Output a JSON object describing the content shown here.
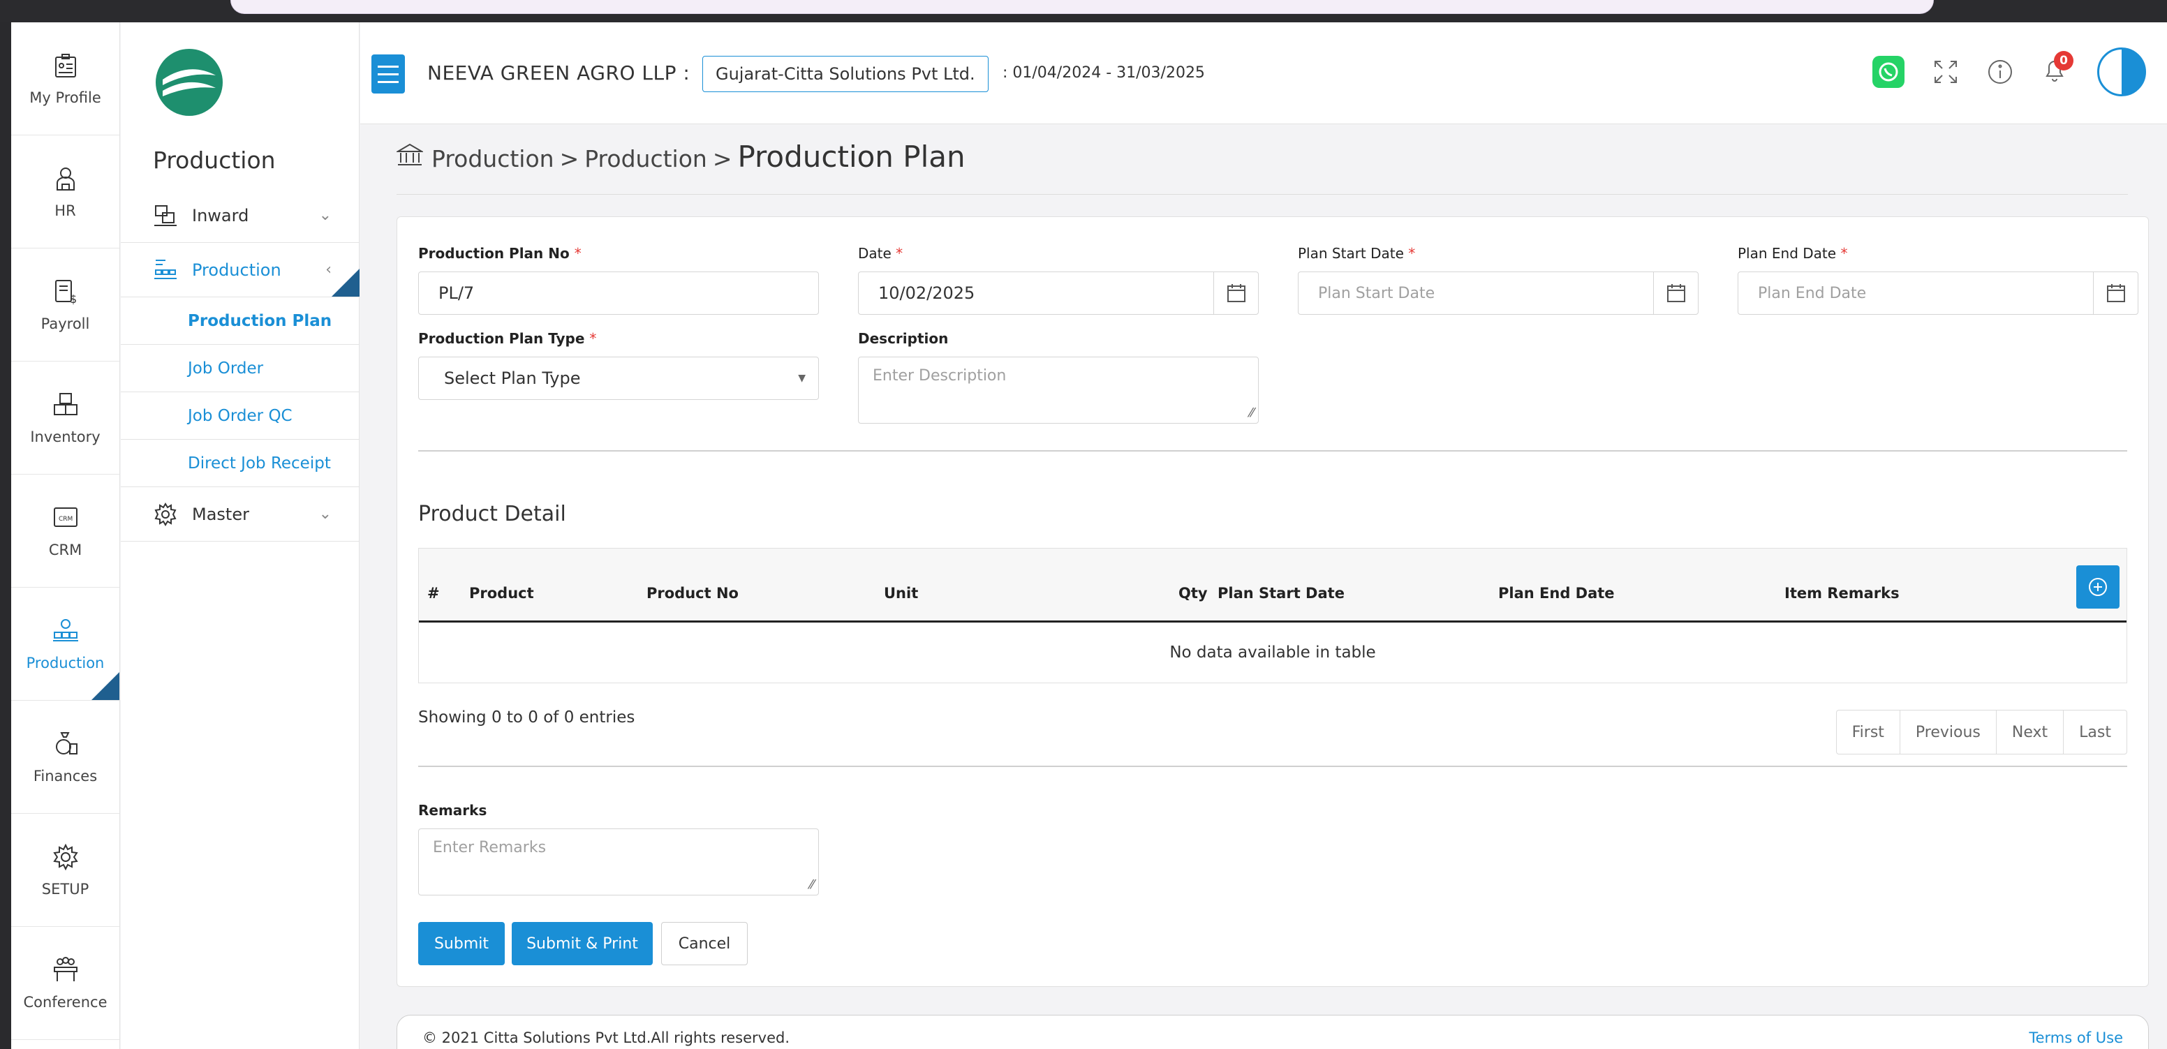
{
  "rail": {
    "items": [
      {
        "label": "My Profile",
        "icon": "profile-icon"
      },
      {
        "label": "HR",
        "icon": "hr-icon"
      },
      {
        "label": "Payroll",
        "icon": "payroll-icon"
      },
      {
        "label": "Inventory",
        "icon": "inventory-icon"
      },
      {
        "label": "CRM",
        "icon": "crm-icon"
      },
      {
        "label": "Production",
        "icon": "production-icon",
        "active": true
      },
      {
        "label": "Finances",
        "icon": "finances-icon"
      },
      {
        "label": "SETUP",
        "icon": "gear-icon"
      },
      {
        "label": "Conference",
        "icon": "conference-icon"
      }
    ]
  },
  "sidebar": {
    "heading": "Production",
    "items": [
      {
        "label": "Inward",
        "icon": "inward-icon",
        "chevron": "⌄"
      },
      {
        "label": "Production",
        "icon": "production-icon",
        "chevron": "‹"
      },
      {
        "label": "Master",
        "icon": "gear-icon",
        "chevron": "⌄"
      }
    ],
    "submenu": [
      "Production Plan",
      "Job Order",
      "Job Order QC",
      "Direct Job Receipt"
    ]
  },
  "header": {
    "company": "NEEVA GREEN AGRO LLP :",
    "company_select": "Gujarat-Citta Solutions Pvt Ltd.",
    "financial_year": ":  01/04/2024 - 31/03/2025",
    "notification_count": "0"
  },
  "breadcrumb": {
    "part1": "Production",
    "sep": ">",
    "part2": "Production",
    "current": "Production Plan"
  },
  "form": {
    "plan_no": {
      "label": "Production Plan No",
      "req": "*",
      "value": "PL/7"
    },
    "date": {
      "label": "Date",
      "req": "*",
      "value": "10/02/2025"
    },
    "start_date": {
      "label": "Plan Start Date",
      "req": "*",
      "placeholder": "Plan Start Date"
    },
    "end_date": {
      "label": "Plan End Date",
      "req": "*",
      "placeholder": "Plan End Date"
    },
    "plan_type": {
      "label": "Production Plan Type",
      "req": "*",
      "value": "Select Plan Type"
    },
    "description": {
      "label": "Description",
      "placeholder": "Enter Description"
    },
    "remarks": {
      "label": "Remarks",
      "placeholder": "Enter Remarks"
    }
  },
  "product_detail": {
    "title": "Product Detail",
    "columns": [
      "#",
      "Product",
      "Product No",
      "Unit",
      "Qty",
      "Plan Start Date",
      "Plan End Date",
      "Item Remarks"
    ],
    "empty": "No data available in table",
    "showing": "Showing 0 to 0 of 0 entries",
    "pager": [
      "First",
      "Previous",
      "Next",
      "Last"
    ]
  },
  "buttons": {
    "submit": "Submit",
    "submit_print": "Submit & Print",
    "cancel": "Cancel"
  },
  "footer": {
    "copyright": "© 2021 Citta Solutions Pvt Ltd.All rights reserved.",
    "terms": "Terms of Use"
  },
  "colors": {
    "accent": "#1a8fd6",
    "dark_accent": "#1f5f8f",
    "required": "#e53935",
    "whatsapp": "#25d366"
  }
}
